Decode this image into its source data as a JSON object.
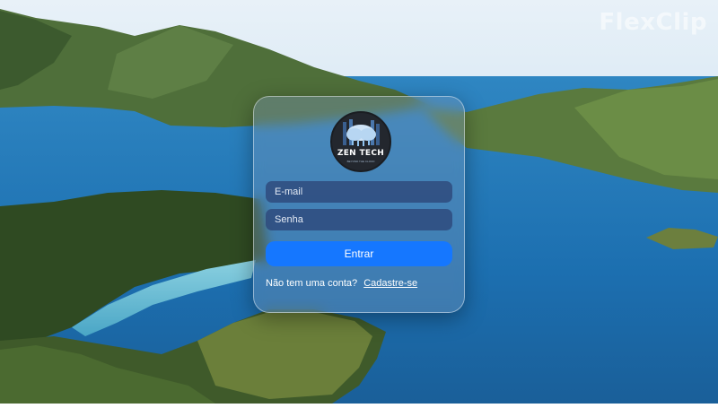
{
  "watermark": "FlexClip",
  "logo": {
    "title": "ZEN TECH",
    "subtitle": "BEYOND THE CLOUD"
  },
  "form": {
    "email_placeholder": "E-mail",
    "password_placeholder": "Senha",
    "submit_label": "Entrar",
    "signup_prompt": "Não tem uma conta?",
    "signup_link": "Cadastre-se"
  }
}
